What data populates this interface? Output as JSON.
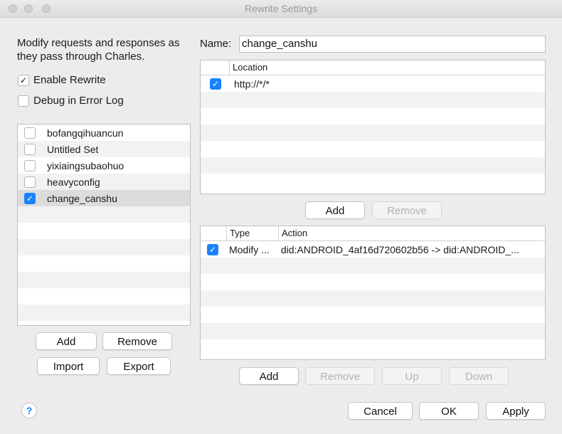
{
  "window": {
    "title": "Rewrite Settings"
  },
  "left": {
    "description": "Modify requests and responses as they pass through Charles.",
    "enable_rewrite": {
      "label": "Enable Rewrite",
      "checked": true
    },
    "debug_log": {
      "label": "Debug in Error Log",
      "checked": false
    },
    "sets": [
      {
        "name": "bofangqihuancun",
        "checked": false
      },
      {
        "name": "Untitled Set",
        "checked": false
      },
      {
        "name": "yixiaingsubaohuo",
        "checked": false
      },
      {
        "name": "heavyconfig",
        "checked": false
      },
      {
        "name": "change_canshu",
        "checked": true
      }
    ],
    "buttons": {
      "add": "Add",
      "remove": "Remove",
      "import": "Import",
      "export": "Export"
    }
  },
  "right": {
    "name_label": "Name:",
    "name_value": "change_canshu",
    "locations": {
      "header": "Location",
      "rows": [
        {
          "checked": true,
          "location": "http://*/*"
        }
      ],
      "buttons": {
        "add": "Add",
        "remove": "Remove"
      }
    },
    "rules": {
      "header_type": "Type",
      "header_action": "Action",
      "rows": [
        {
          "checked": true,
          "type": "Modify ...",
          "action": "did:ANDROID_4af16d720602b56 -> did:ANDROID_..."
        }
      ],
      "buttons": {
        "add": "Add",
        "remove": "Remove",
        "up": "Up",
        "down": "Down"
      }
    }
  },
  "footer": {
    "help": "?",
    "cancel": "Cancel",
    "ok": "OK",
    "apply": "Apply"
  },
  "colors": {
    "accent": "#1a82fb",
    "background": "#ececec"
  }
}
